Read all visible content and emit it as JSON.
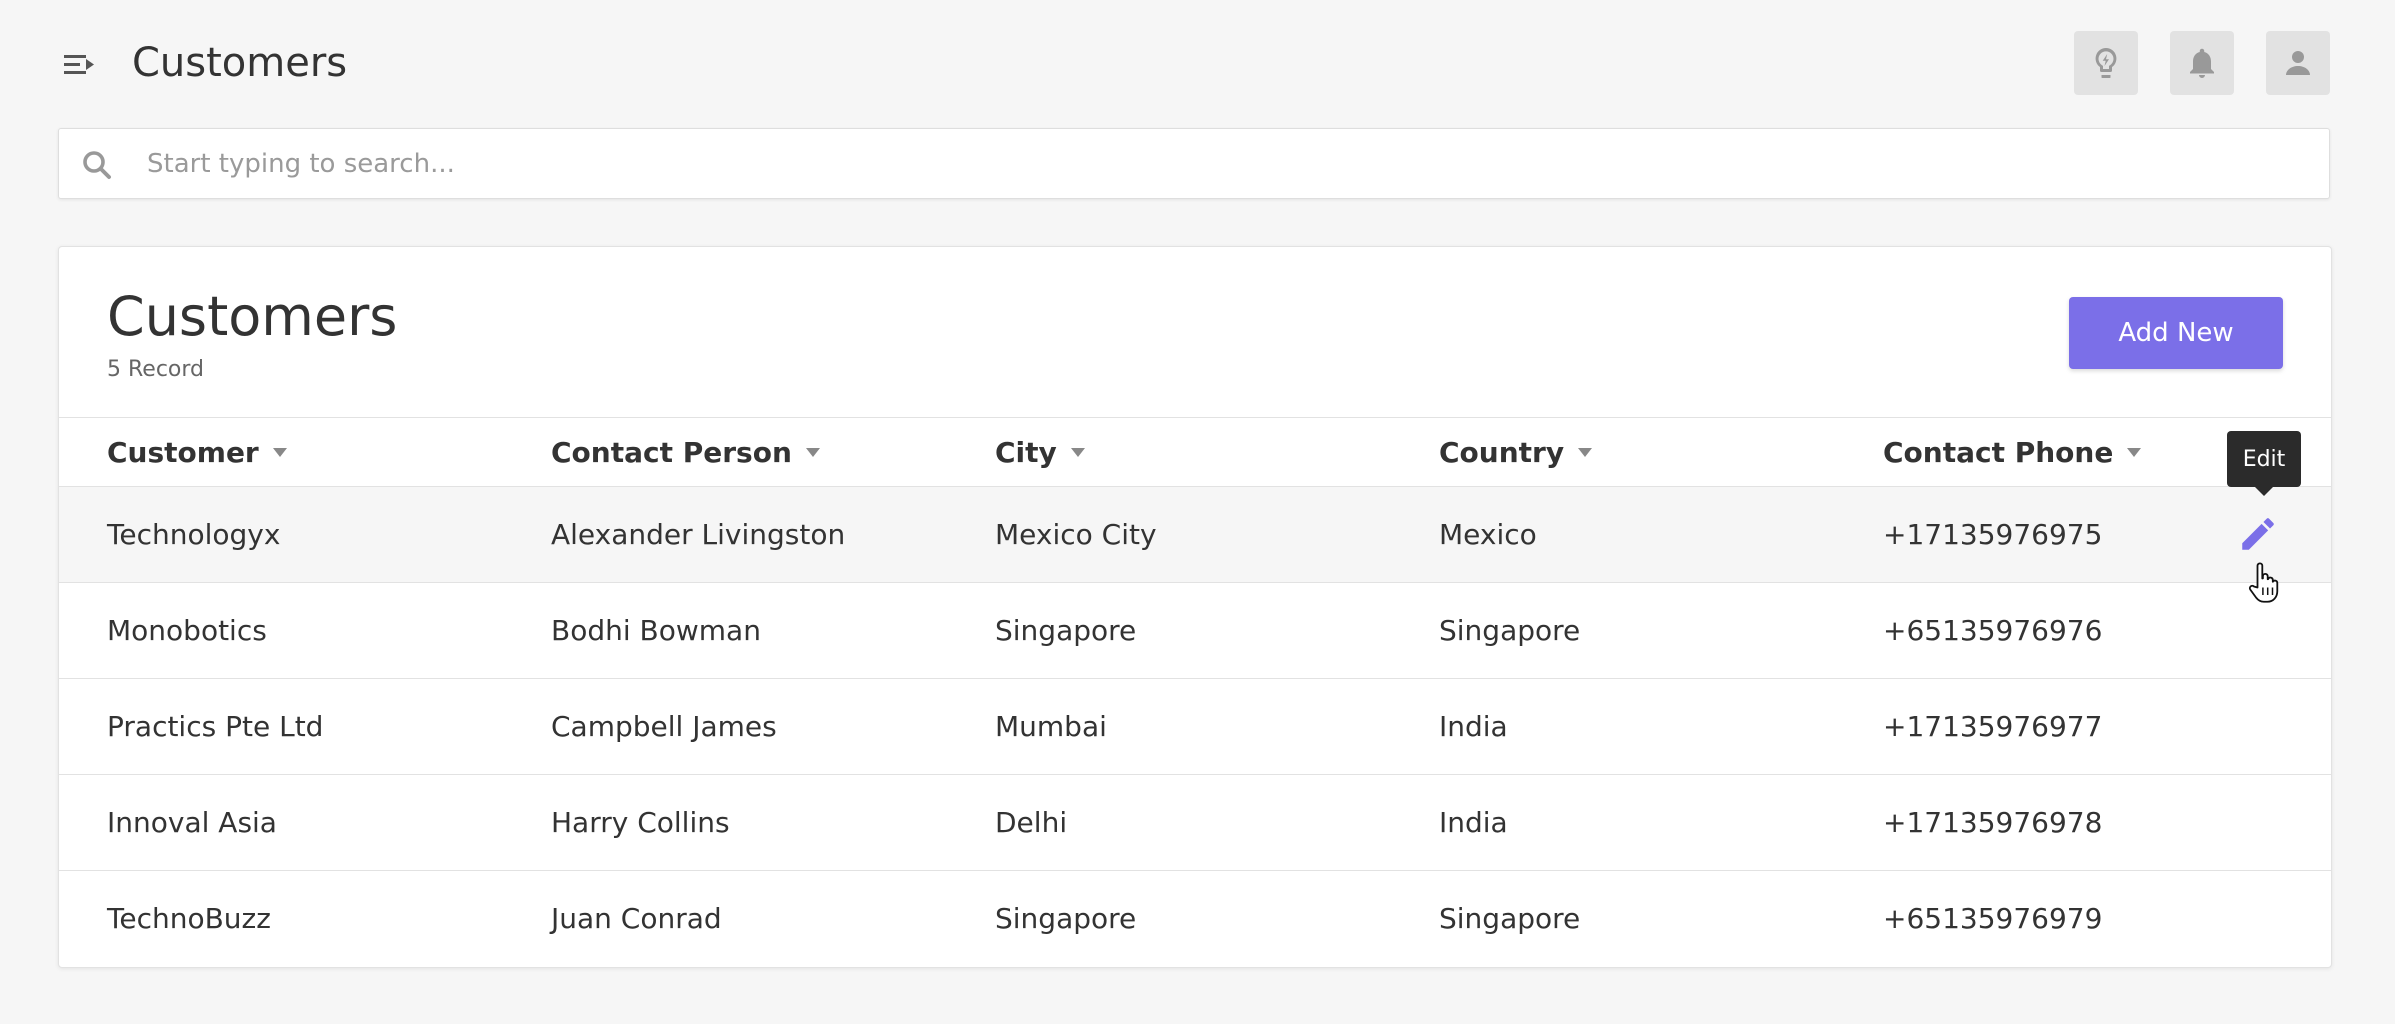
{
  "header": {
    "title": "Customers",
    "menu_icon": "menu-collapse-icon",
    "buttons": [
      {
        "name": "ideas",
        "icon": "lightbulb-icon"
      },
      {
        "name": "notifications",
        "icon": "bell-icon"
      },
      {
        "name": "profile",
        "icon": "user-icon"
      }
    ]
  },
  "search": {
    "placeholder": "Start typing to search...",
    "value": "",
    "icon": "search-icon"
  },
  "card": {
    "title": "Customers",
    "record_count": "5 Record",
    "add_button": "Add New"
  },
  "table": {
    "columns": [
      "Customer",
      "Contact Person",
      "City",
      "Country",
      "Contact Phone"
    ],
    "rows": [
      {
        "customer": "Technologyx",
        "contact": "Alexander Livingston",
        "city": "Mexico City",
        "country": "Mexico",
        "phone": "+17135976975"
      },
      {
        "customer": "Monobotics",
        "contact": "Bodhi Bowman",
        "city": "Singapore",
        "country": "Singapore",
        "phone": "+65135976976"
      },
      {
        "customer": "Practics Pte Ltd",
        "contact": "Campbell James",
        "city": "Mumbai",
        "country": "India",
        "phone": "+17135976977"
      },
      {
        "customer": "Innoval Asia",
        "contact": "Harry Collins",
        "city": "Delhi",
        "country": "India",
        "phone": "+17135976978"
      },
      {
        "customer": "TechnoBuzz",
        "contact": "Juan Conrad",
        "city": "Singapore",
        "country": "Singapore",
        "phone": "+65135976979"
      }
    ],
    "edit_tooltip": "Edit",
    "edit_icon": "pencil-icon"
  },
  "colors": {
    "accent": "#7b6fe8",
    "background": "#f6f6f6",
    "tooltip": "#2b2b2b"
  }
}
